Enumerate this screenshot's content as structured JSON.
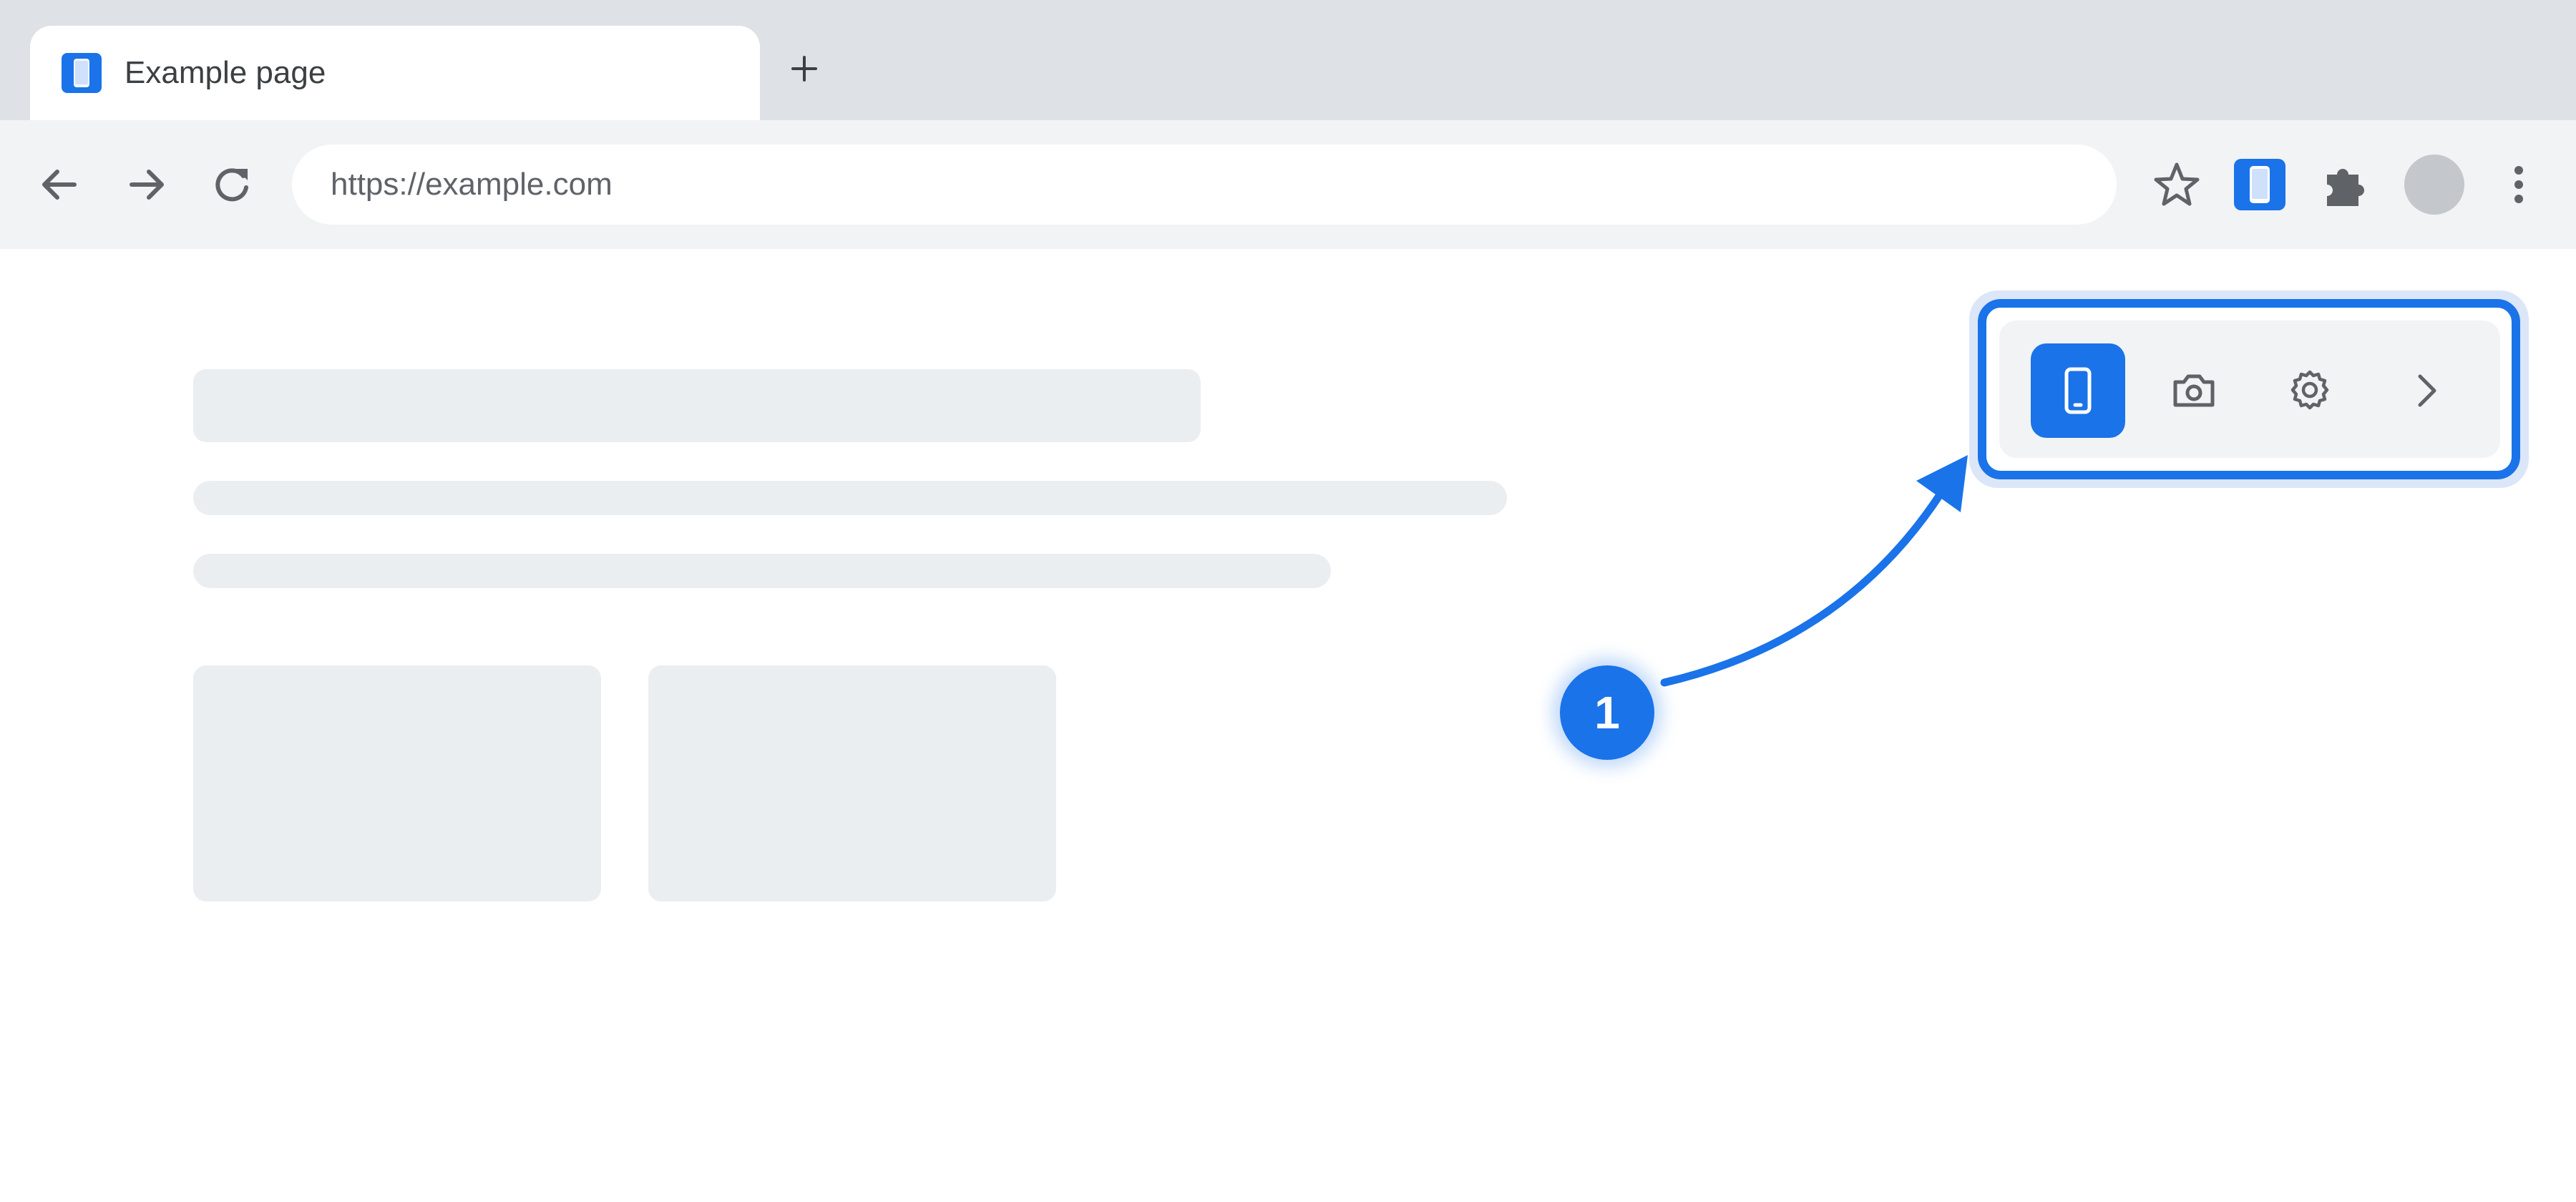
{
  "tab": {
    "title": "Example page",
    "favicon": "phone-icon"
  },
  "toolbar": {
    "url": "https://example.com",
    "back_icon": "arrow-left-icon",
    "forward_icon": "arrow-right-icon",
    "reload_icon": "reload-icon",
    "bookmark_icon": "star-icon",
    "extension_icon": "phone-icon",
    "extensions_menu_icon": "puzzle-icon",
    "menu_icon": "more-vert-icon"
  },
  "popup": {
    "buttons": [
      {
        "icon": "phone-icon",
        "active": true
      },
      {
        "icon": "camera-icon",
        "active": false
      },
      {
        "icon": "gear-icon",
        "active": false
      },
      {
        "icon": "chevron-right-icon",
        "active": false
      }
    ]
  },
  "annotation": {
    "step": "1"
  },
  "colors": {
    "accent": "#1a73e8",
    "tabstrip": "#dee1e6",
    "toolbar": "#f1f3f4",
    "skeleton": "#ebeef1",
    "icon": "#5f6368"
  }
}
